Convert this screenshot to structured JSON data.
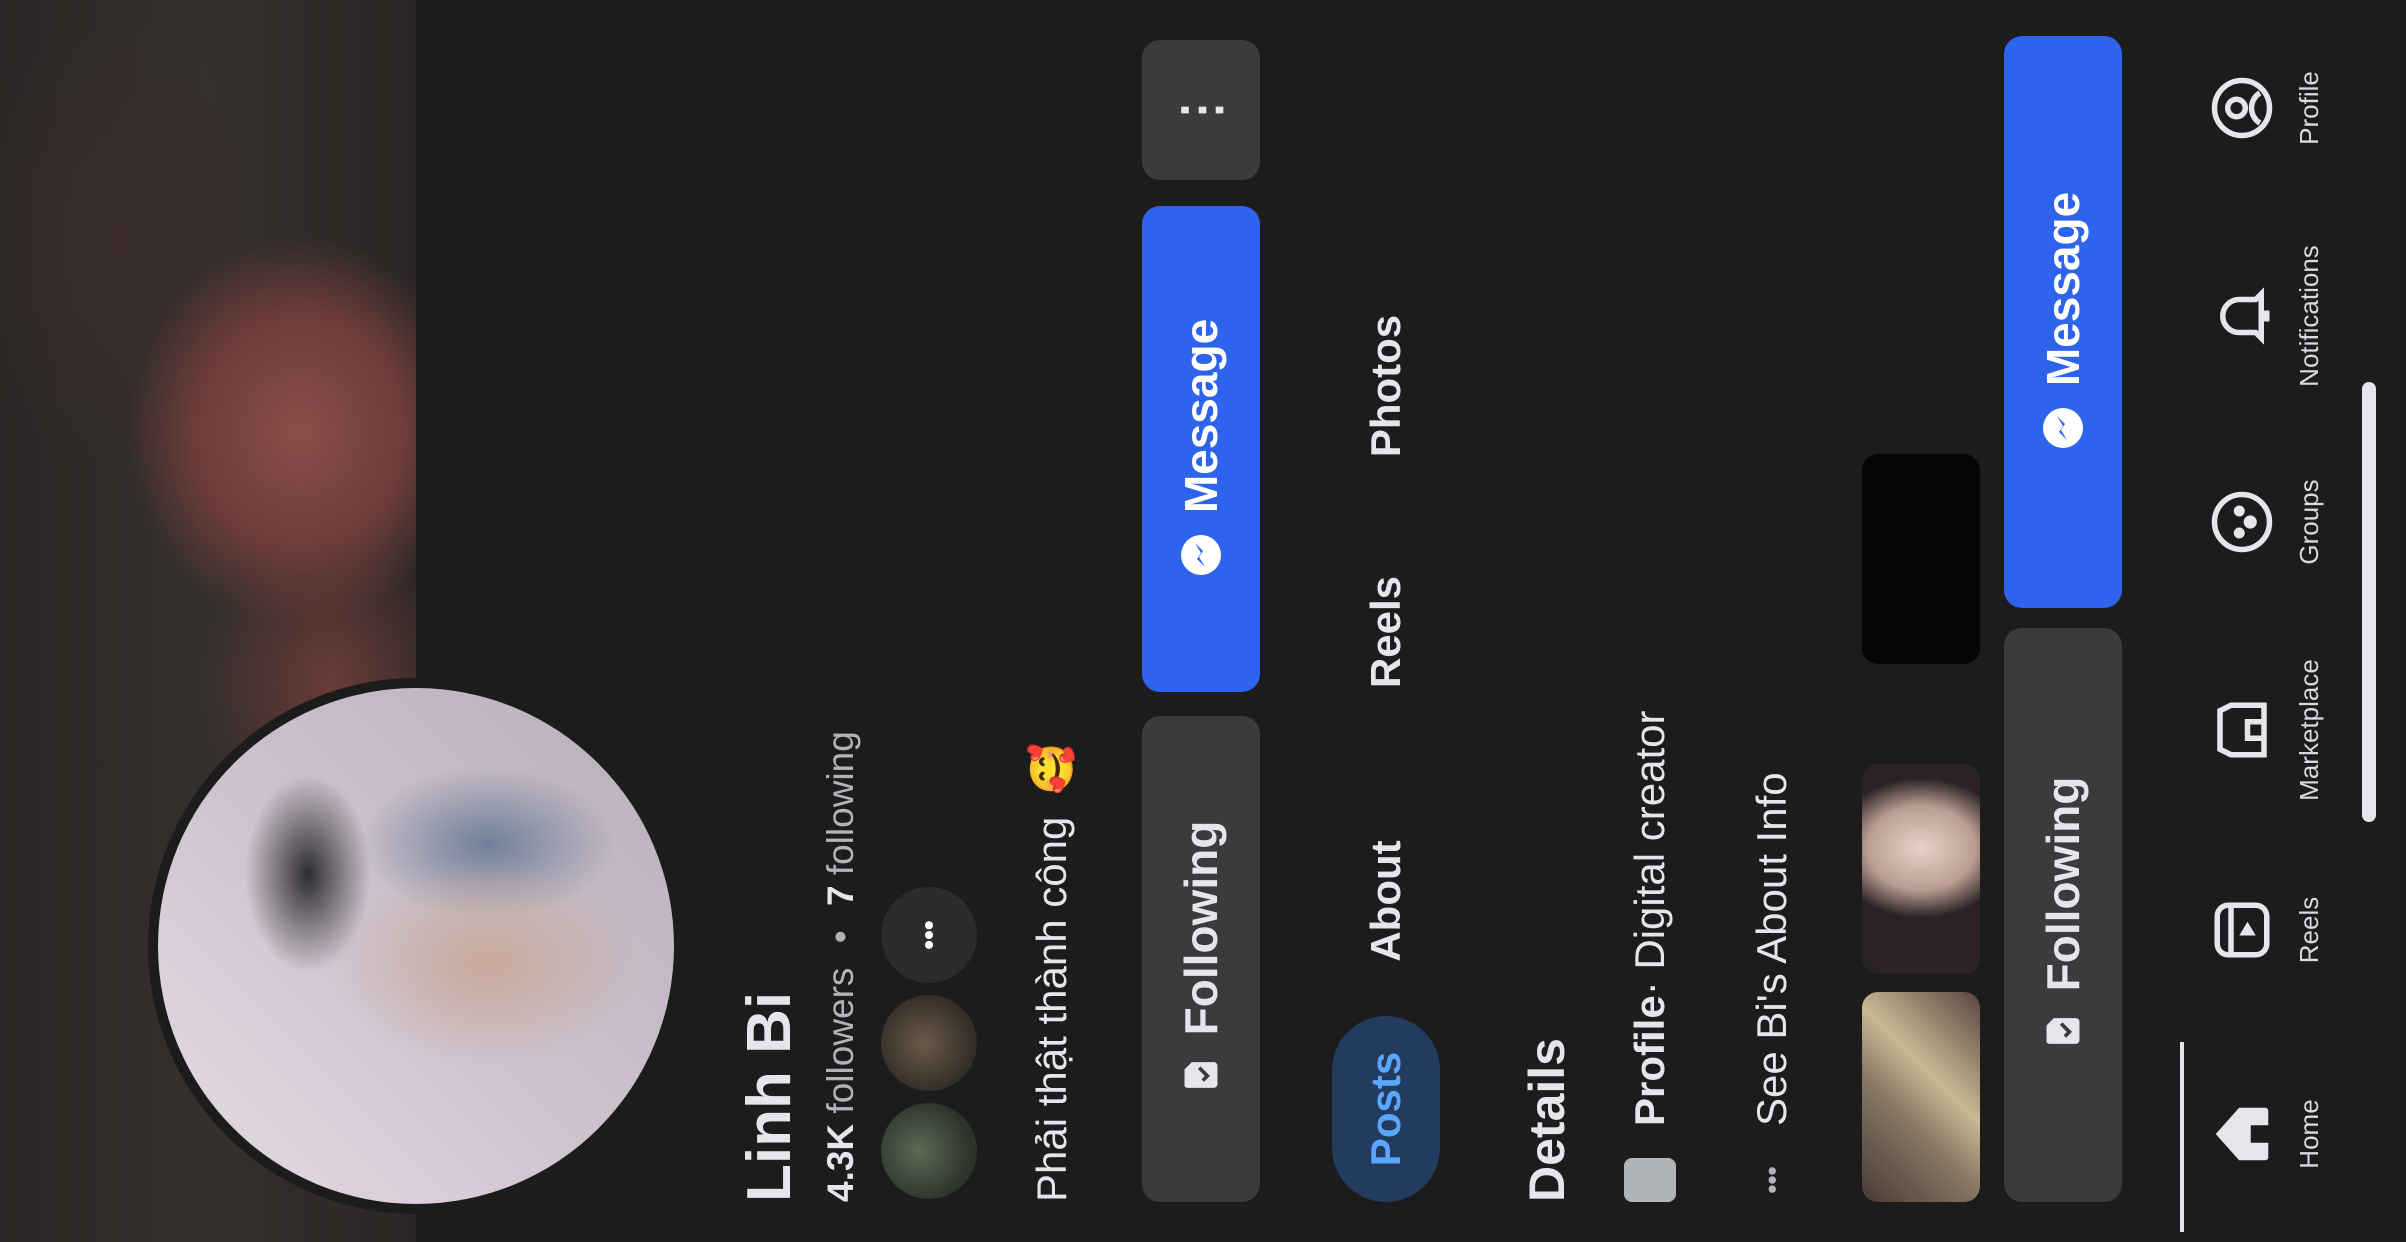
{
  "profile": {
    "name": "Linh Bi",
    "followers_count": "4.3K",
    "followers_label": "followers",
    "separator": "•",
    "following_count": "7",
    "following_label": "following",
    "bio_text": "Phải thật thành công",
    "bio_emoji": "🥰",
    "more_mutuals": "•••"
  },
  "actions": {
    "following_label": "Following",
    "message_label": "Message",
    "more_label": "⋮"
  },
  "tabs": [
    {
      "label": "Posts"
    },
    {
      "label": "About"
    },
    {
      "label": "Reels"
    },
    {
      "label": "Photos"
    }
  ],
  "details": {
    "title": "Details",
    "profile_type_bold": "Profile",
    "profile_type_rest": " · Digital creator",
    "about_link": "See Bi's About Info",
    "about_icon": "•••"
  },
  "sticky": {
    "following_label": "Following",
    "message_label": "Message"
  },
  "nav": [
    {
      "label": "Home",
      "icon": "home-icon"
    },
    {
      "label": "Reels",
      "icon": "reels-icon"
    },
    {
      "label": "Marketplace",
      "icon": "marketplace-icon"
    },
    {
      "label": "Groups",
      "icon": "groups-icon"
    },
    {
      "label": "Notifications",
      "icon": "bell-icon"
    },
    {
      "label": "Profile",
      "icon": "profile-icon"
    }
  ],
  "colors": {
    "background": "#1c1c1d",
    "accent": "#2d63ed",
    "button_gray": "#3a3b3c",
    "active_tab_bg": "#233b5e",
    "active_tab_text": "#5aa7ff"
  }
}
